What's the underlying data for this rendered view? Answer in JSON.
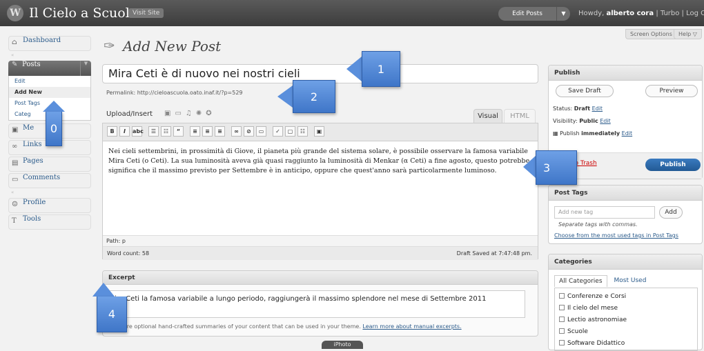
{
  "topbar": {
    "wp_logo": "W",
    "site_title": "Il Cielo a Scuola",
    "visit_site": "Visit Site",
    "edit_posts": "Edit Posts",
    "dropdown_glyph": "▼",
    "howdy_prefix": "Howdy,",
    "username": "alberto cora",
    "links": "| Turbo | Log Ou"
  },
  "screen_options": "Screen Options ▽",
  "help": "Help ▽",
  "sidebar": {
    "dashboard": "Dashboard",
    "posts": "Posts",
    "posts_sub": [
      "Edit",
      "Add New",
      "Post Tags",
      "Categ"
    ],
    "media": "Me",
    "links": "Links",
    "pages": "Pages",
    "comments": "Comments",
    "profile": "Profile",
    "tools": "Tools"
  },
  "main": {
    "page_title": "Add New Post",
    "title_value": "Mira Ceti è di nuovo nei nostri cieli",
    "permalink": "Permalink: http://cieloascuola.oato.inaf.it/?p=529",
    "upload_label": "Upload/Insert",
    "tab_visual": "Visual",
    "tab_html": "HTML",
    "body": "Nei cieli settembrini, in prossimità di Giove, il pianeta più grande del sistema solare, è possibile osservare la famosa variabile Mira Ceti (o Ceti). La sua luminosità aveva già quasi raggiunto la luminosità di Menkar (α Ceti) a fine agosto, questo potrebbe significa che il massimo previsto per Settembre è in anticipo, oppure che quest'anno sarà particolarmente luminoso.",
    "path": "Path: p",
    "word_count": "Word count: 58",
    "draft_saved": "Draft Saved at 7:47:48 pm.",
    "excerpt_title": "Excerpt",
    "excerpt_value": "ira Ceti la famosa variabile a lungo periodo, raggiungerà il massimo splendore nel mese di Settembre 2011",
    "excerpt_help": "ts are optional hand-crafted summaries of your content that can be used in your theme.",
    "excerpt_help_link": "Learn more about manual excerpts."
  },
  "publish": {
    "title": "Publish",
    "save_draft": "Save Draft",
    "preview": "Preview",
    "status_label": "Status:",
    "status_value": "Draft",
    "visibility_label": "Visibility:",
    "visibility_value": "Public",
    "publish_label": "Publish",
    "publish_value": "immediately",
    "edit": "Edit",
    "trash": "to Trash",
    "publish_btn": "Publish"
  },
  "tags": {
    "title": "Post Tags",
    "placeholder": "Add new tag",
    "add": "Add",
    "hint": "Separate tags with commas.",
    "choose": "Choose from the most used tags in Post Tags"
  },
  "categories": {
    "title": "Categories",
    "tab_all": "All Categories",
    "tab_most": "Most Used",
    "items": [
      "Conferenze e Corsi",
      "Il cielo del mese",
      "Lectio astronomiae",
      "Scuole",
      "Software Didattico"
    ]
  },
  "callouts": [
    "0",
    "1",
    "2",
    "3",
    "4"
  ],
  "iphoto": "iPhoto"
}
